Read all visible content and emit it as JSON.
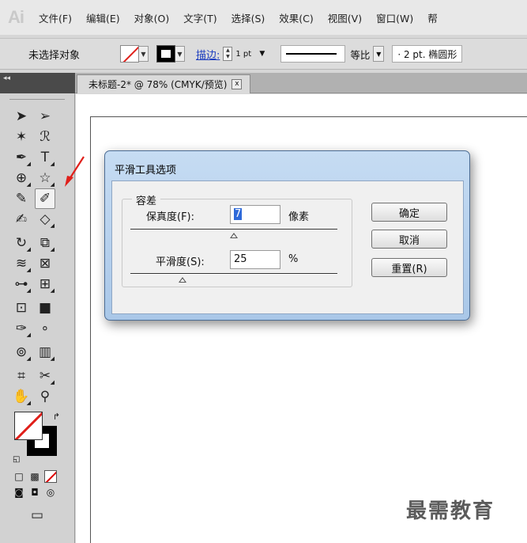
{
  "app": {
    "logo": "Ai"
  },
  "menu": [
    "文件(F)",
    "编辑(E)",
    "对象(O)",
    "文字(T)",
    "选择(S)",
    "效果(C)",
    "视图(V)",
    "窗口(W)",
    "帮"
  ],
  "control_bar": {
    "selection_status": "未选择对象",
    "stroke_label": "描边:",
    "stroke_weight": "1 pt",
    "profile": "等比",
    "brush": "·  2 pt. 椭圆形"
  },
  "tab": {
    "panel_collapse": "◂◂",
    "document_title": "未标题-2* @ 78% (CMYK/预览)",
    "close_glyph": "x"
  },
  "tools": {
    "icons": [
      "selection-icon",
      "direct-selection-icon",
      "magic-wand-icon",
      "lasso-icon",
      "pen-icon",
      "type-icon",
      "line-segment-icon",
      "rectangle-icon",
      "paintbrush-icon",
      "pencil-icon",
      "blob-brush-icon",
      "eraser-icon",
      "rotate-icon",
      "scale-icon",
      "warp-icon",
      "free-transform-icon",
      "shape-builder-icon",
      "perspective-grid-icon",
      "mesh-icon",
      "gradient-icon",
      "eyedropper-icon",
      "blend-icon",
      "symbol-sprayer-icon",
      "column-graph-icon",
      "artboard-icon",
      "slice-icon",
      "hand-icon",
      "zoom-icon"
    ],
    "active_tool": "pencil-icon"
  },
  "dialog": {
    "title": "平滑工具选项",
    "group_label": "容差",
    "fidelity": {
      "label": "保真度(F):",
      "value": "7",
      "unit": "像素",
      "slider_fraction": 0.5
    },
    "smoothness": {
      "label": "平滑度(S):",
      "value": "25",
      "unit": "%",
      "slider_fraction": 0.25
    },
    "buttons": {
      "ok": "确定",
      "cancel": "取消",
      "reset": "重置(R)"
    }
  },
  "watermark": "最需教育",
  "colors": {
    "accent_red": "#e0201b",
    "dialog_frame": "#b8d1ee",
    "selection_blue": "#2e69d9"
  }
}
